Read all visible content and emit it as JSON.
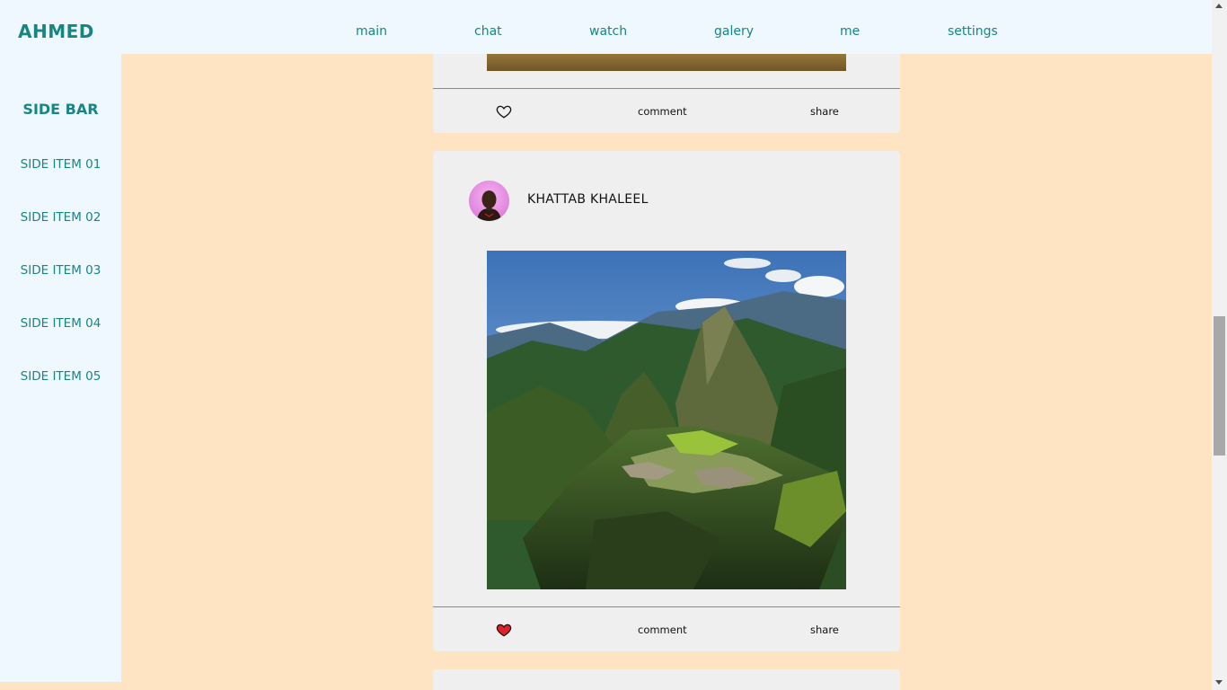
{
  "header": {
    "brand": "AHMED",
    "nav": [
      {
        "label": "main"
      },
      {
        "label": "chat"
      },
      {
        "label": "watch"
      },
      {
        "label": "galery"
      },
      {
        "label": "me"
      },
      {
        "label": "settings"
      }
    ]
  },
  "sidebar": {
    "title": "SIDE BAR",
    "items": [
      {
        "label": "SIDE ITEM 01"
      },
      {
        "label": "SIDE ITEM 02"
      },
      {
        "label": "SIDE ITEM 03"
      },
      {
        "label": "SIDE ITEM 04"
      },
      {
        "label": "SIDE ITEM 05"
      }
    ]
  },
  "feed": {
    "posts": [
      {
        "author": "",
        "liked": false,
        "actions": {
          "comment": "comment",
          "share": "share"
        }
      },
      {
        "author": "KHATTAB KHALEEL",
        "liked": true,
        "actions": {
          "comment": "comment",
          "share": "share"
        }
      }
    ]
  },
  "colors": {
    "accent": "#178683",
    "page_background": "#ffe4c4",
    "panel_background": "#f0f8ff",
    "card_background": "#efefef",
    "like_active": "#e0202b"
  },
  "icons": {
    "like_outline": "heart-outline-icon",
    "like_filled": "heart-filled-icon"
  }
}
